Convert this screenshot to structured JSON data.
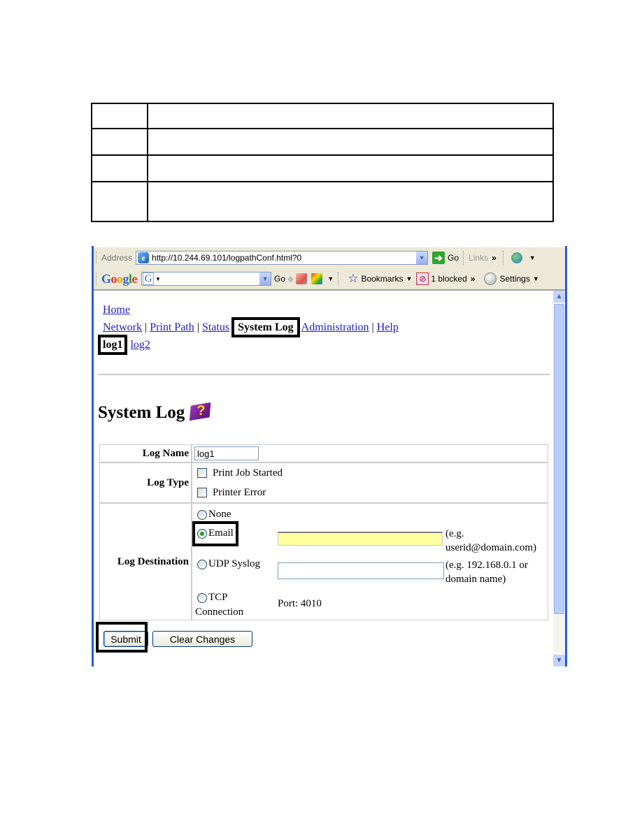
{
  "doc_table": {
    "rows": [
      [
        "",
        ""
      ],
      [
        "",
        ""
      ],
      [
        "",
        ""
      ],
      [
        "",
        ""
      ]
    ]
  },
  "browser": {
    "address_label": "Address",
    "url": "http://10.244.69.101/logpathConf.html?0",
    "go_label": "Go",
    "links_label": "Links",
    "google_toolbar": {
      "logo": [
        "G",
        "o",
        "o",
        "g",
        "l",
        "e"
      ],
      "go_label": "Go",
      "bookmarks_label": "Bookmarks",
      "blocked_label": "1 blocked",
      "settings_label": "Settings"
    }
  },
  "nav": {
    "home": "Home",
    "items": [
      "Network",
      "Print Path",
      "Status",
      "System Log",
      "Administration",
      "Help"
    ],
    "current": "System Log",
    "sub_items": [
      "log1",
      "log2"
    ],
    "sub_current": "log1"
  },
  "page": {
    "title": "System Log",
    "help_icon": "help-book-icon"
  },
  "form": {
    "log_name_label": "Log Name",
    "log_name_value": "log1",
    "log_type_label": "Log Type",
    "log_types": [
      {
        "label": "Print Job Started",
        "checked": false
      },
      {
        "label": "Printer Error",
        "checked": false
      }
    ],
    "log_destination_label": "Log Destination",
    "destinations": [
      {
        "label": "None",
        "selected": false
      },
      {
        "label": "Email",
        "selected": true
      },
      {
        "label": "UDP Syslog",
        "selected": false
      },
      {
        "label": "TCP",
        "label2": "Connection",
        "selected": false
      }
    ],
    "email_value": "",
    "email_hint_1": "(e.g.",
    "email_hint_2": "userid@domain.com)",
    "udp_value": "",
    "udp_hint_1": "(e.g. 192.168.0.1 or",
    "udp_hint_2": "domain name)",
    "tcp_port": "Port: 4010",
    "submit_label": "Submit",
    "clear_label": "Clear Changes"
  }
}
